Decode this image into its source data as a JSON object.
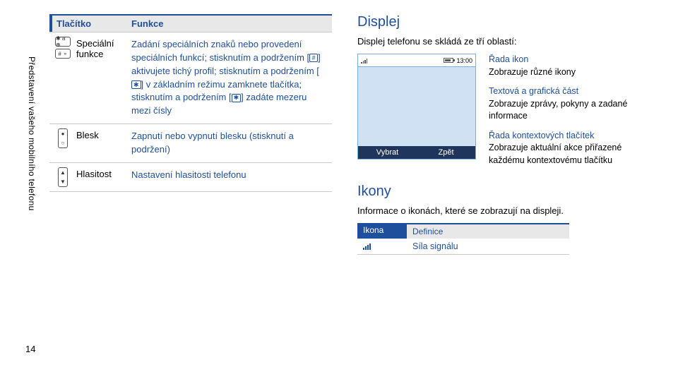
{
  "side_label": "Představení vašeho mobilního telefonu",
  "page_number": "14",
  "left_table": {
    "header_col1": "Tlačítko",
    "header_col2": "Funkce",
    "rows": {
      "special": {
        "name": "Speciální funkce",
        "key_labels": [
          "✱ a ⊕",
          "# ⚬"
        ],
        "desc_parts": {
          "a": "Zadání speciálních znaků nebo provedení speciálních funkcí; stisknutím a podržením [",
          "k1": "#",
          "b": "] aktivujete tichý profil; stisknutím a podržením [",
          "k2": "✱",
          "c": "] v základním režimu zamknete tlačítka; stisknutím a podržením [",
          "k3": "✱",
          "d": "] zadáte mezeru mezi čísly"
        }
      },
      "flash": {
        "name": "Blesk",
        "key_up": "●",
        "key_dn": "○",
        "desc": "Zapnutí nebo vypnutí blesku (stisknutí a podržení)"
      },
      "volume": {
        "name": "Hlasitost",
        "key_up": "▲",
        "key_dn": "▼",
        "desc": "Nastavení hlasitosti telefonu"
      }
    }
  },
  "right": {
    "h_display": "Displej",
    "lead": "Displej telefonu se skládá ze tří oblastí:",
    "phone": {
      "time": "13:00",
      "soft_left": "Vybrat",
      "soft_right": "Zpět"
    },
    "legend": {
      "icons_title": "Řada ikon",
      "icons_desc": "Zobrazuje různé ikony",
      "text_title": "Textová a grafická část",
      "text_desc": "Zobrazuje zprávy, pokyny a zadané informace",
      "soft_title": "Řada kontextových tlačítek",
      "soft_desc": "Zobrazuje aktuální akce přiřazené každému kontextovému tlačítku"
    },
    "h_icons": "Ikony",
    "icons_lead": "Informace o ikonách, které se zobrazují na displeji.",
    "mini_h1": "Ikona",
    "mini_h2": "Definice",
    "mini_row1": "Síla signálu"
  }
}
